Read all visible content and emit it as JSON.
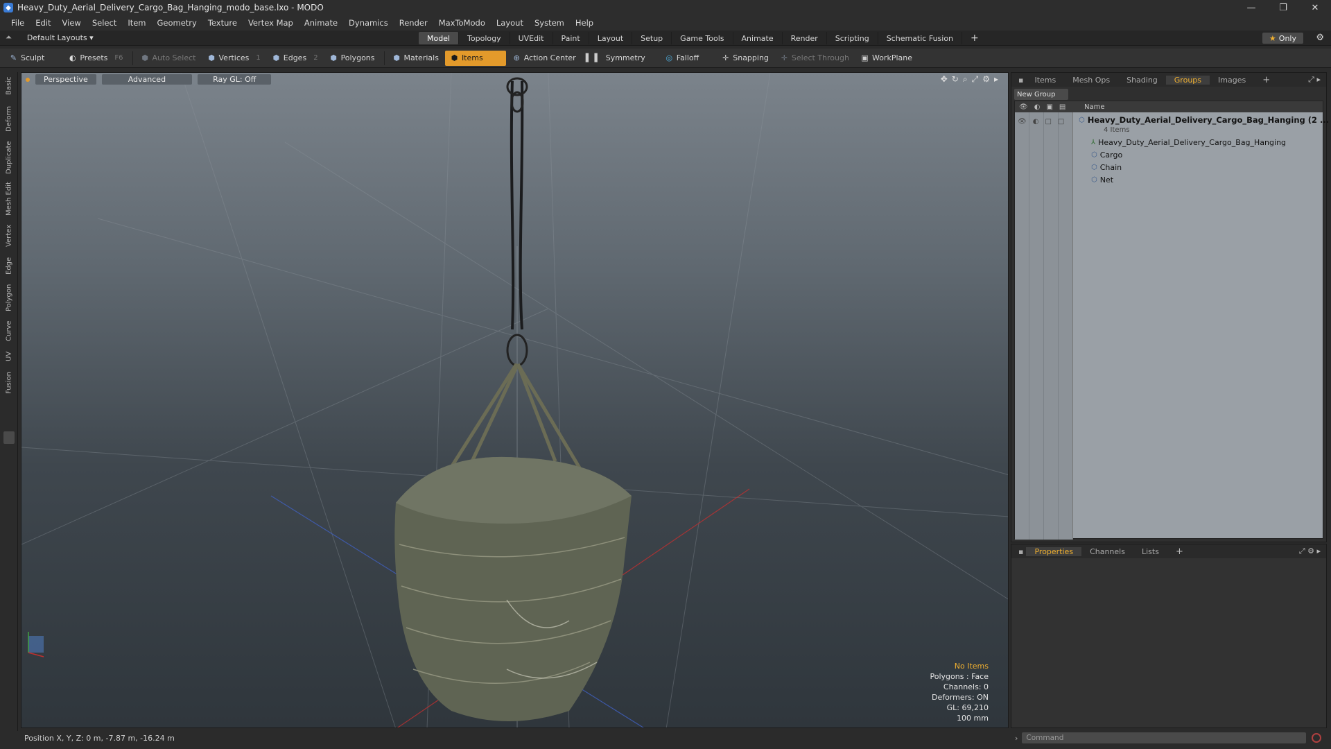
{
  "window": {
    "title": "Heavy_Duty_Aerial_Delivery_Cargo_Bag_Hanging_modo_base.lxo - MODO",
    "controls": [
      "—",
      "❐",
      "✕"
    ]
  },
  "menu": [
    "File",
    "Edit",
    "View",
    "Select",
    "Item",
    "Geometry",
    "Texture",
    "Vertex Map",
    "Animate",
    "Dynamics",
    "Render",
    "MaxToModo",
    "Layout",
    "System",
    "Help"
  ],
  "layouts": {
    "label": "Default Layouts ▾"
  },
  "modes": [
    "Model",
    "Topology",
    "UVEdit",
    "Paint",
    "Layout",
    "Setup",
    "Game Tools",
    "Animate",
    "Render",
    "Scripting",
    "Schematic Fusion"
  ],
  "modes_active": "Model",
  "only_label": "Only",
  "toolbar": {
    "sculpt": "Sculpt",
    "presets": "Presets",
    "presets_key": "F6",
    "auto_select": "Auto Select",
    "vertices": "Vertices",
    "vertices_key": "1",
    "edges": "Edges",
    "edges_key": "2",
    "polygons": "Polygons",
    "materials": "Materials",
    "items": "Items",
    "action_center": "Action Center",
    "symmetry": "Symmetry",
    "falloff": "Falloff",
    "snapping": "Snapping",
    "select_through": "Select Through",
    "workplane": "WorkPlane"
  },
  "left_tabs": [
    "Basic",
    "Deform",
    "Duplicate",
    "Mesh Edit",
    "Vertex",
    "Edge",
    "Polygon",
    "Curve",
    "UV",
    "Fusion"
  ],
  "viewport": {
    "view": "Perspective",
    "shading": "Advanced",
    "raygl": "Ray GL: Off",
    "info": {
      "items": "No Items",
      "polygons": "Polygons : Face",
      "channels": "Channels: 0",
      "deformers": "Deformers: ON",
      "gl": "GL: 69,210",
      "scale": "100 mm"
    }
  },
  "status": {
    "position": "Position X, Y, Z:  0 m, -7.87 m, -16.24 m"
  },
  "right_panel": {
    "tabs": [
      "Items",
      "Mesh Ops",
      "Shading",
      "Groups",
      "Images"
    ],
    "active_tab": "Groups",
    "new_group": "New Group",
    "name_header": "Name",
    "group_name": "Heavy_Duty_Aerial_Delivery_Cargo_Bag_Hanging (2 ...",
    "group_count": "4 Items",
    "children": [
      "Heavy_Duty_Aerial_Delivery_Cargo_Bag_Hanging",
      "Cargo",
      "Chain",
      "Net"
    ]
  },
  "properties_panel": {
    "tabs": [
      "Properties",
      "Channels",
      "Lists"
    ],
    "active_tab": "Properties"
  },
  "command": {
    "placeholder": "Command"
  },
  "colors": {
    "accent": "#e39a2b",
    "active_tab_text": "#f0b030",
    "viewport_top": "#7b838b",
    "viewport_bottom": "#2f363c"
  }
}
